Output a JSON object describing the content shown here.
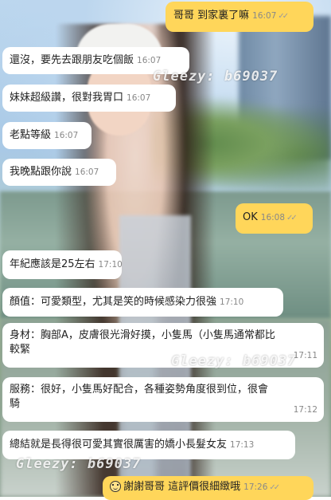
{
  "watermark": "Gleezy: b69037",
  "messages": [
    {
      "side": "out",
      "text": "哥哥 到家裏了嘛",
      "time": "16:07",
      "read": "✓✓"
    },
    {
      "side": "in",
      "text": "還沒，要先去跟朋友吃個飯",
      "time": "16:07"
    },
    {
      "side": "in",
      "text": "妹妹超級讚，很對我胃口",
      "time": "16:07"
    },
    {
      "side": "in",
      "text": "老點等級",
      "time": "16:07"
    },
    {
      "side": "in",
      "text": "我晚點跟你說",
      "time": "16:07"
    },
    {
      "side": "out",
      "text": "OK",
      "time": "16:08",
      "read": "✓✓"
    },
    {
      "side": "in",
      "text": "年紀應該是25左右",
      "time": "17:10"
    },
    {
      "side": "in",
      "text": "顏值：可愛類型，尤其是笑的時候感染力很強",
      "time": "17:10"
    },
    {
      "side": "in",
      "text_line1": "身材：胸部A，皮膚很光滑好摸，小隻馬（小隻馬通常都比",
      "text_line2": "較緊",
      "time": "17:11"
    },
    {
      "side": "in",
      "text_line1": "服務：很好，小隻馬好配合，各種姿勢角度很到位，很會",
      "text_line2": "騎",
      "time": "17:12"
    },
    {
      "side": "in",
      "text": "總結就是長得很可愛其實很厲害的嬌小長髮女友",
      "time": "17:13"
    },
    {
      "side": "out",
      "emoji": "smile-emoji",
      "text": "謝謝哥哥 這評價很細緻哦",
      "time": "17:26",
      "read": "✓✓"
    }
  ]
}
